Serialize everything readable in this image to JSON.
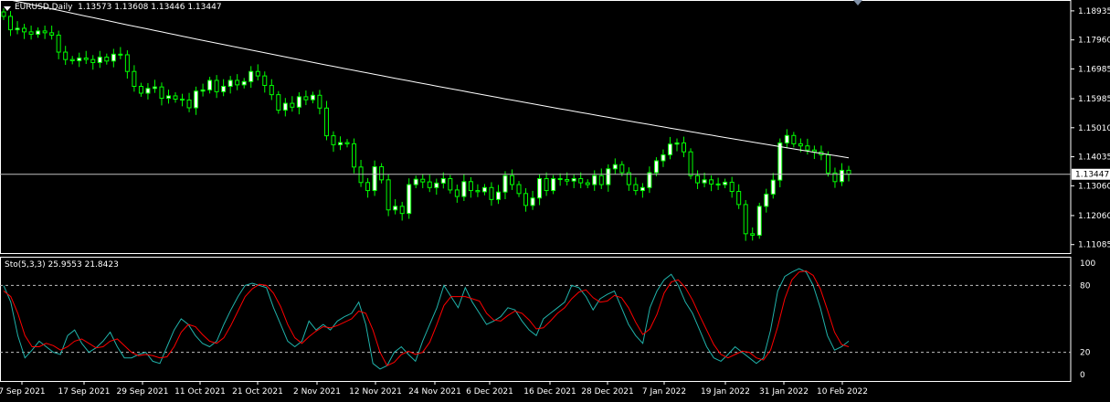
{
  "window": {
    "symbol_header": "EURUSD,Daily  1.13573 1.13608 1.13446 1.13447",
    "oscillator_header": "Sto(5,3,3) 25.9553 21.8423"
  },
  "colors": {
    "background": "#000000",
    "bull_candle": "#00ff00",
    "bear_candle_body": "#ffffff",
    "moving_average": "#ffffff",
    "stoch_main": "#20b2aa",
    "stoch_signal": "#ff0000",
    "grid_frame": "#ffffff",
    "levels": "#c0c0c0"
  },
  "chart_data": [
    {
      "type": "candlestick",
      "symbol": "EURUSD",
      "timeframe": "Daily",
      "ohlc_last": {
        "open": 1.13573,
        "high": 1.13608,
        "low": 1.13446,
        "close": 1.13447
      },
      "y_ticks": [
        1.18935,
        1.1796,
        1.16985,
        1.15985,
        1.1501,
        1.14035,
        1.1306,
        1.1206,
        1.11085
      ],
      "current_price_label": "1.13447",
      "ylim": [
        1.108,
        1.193
      ],
      "x_tick_labels": [
        "7 Sep 2021",
        "17 Sep 2021",
        "29 Sep 2021",
        "11 Oct 2021",
        "21 Oct 2021",
        "2 Nov 2021",
        "12 Nov 2021",
        "24 Nov 2021",
        "6 Dec 2021",
        "16 Dec 2021",
        "28 Dec 2021",
        "7 Jan 2022",
        "19 Jan 2022",
        "31 Jan 2022",
        "10 Feb 2022"
      ],
      "closes": [
        1.1875,
        1.183,
        1.1835,
        1.1823,
        1.1815,
        1.1826,
        1.182,
        1.1812,
        1.1755,
        1.173,
        1.1726,
        1.1735,
        1.173,
        1.172,
        1.1738,
        1.1725,
        1.1748,
        1.1746,
        1.169,
        1.164,
        1.1617,
        1.1633,
        1.1638,
        1.16,
        1.1608,
        1.1597,
        1.1594,
        1.1568,
        1.1624,
        1.1628,
        1.166,
        1.1622,
        1.164,
        1.166,
        1.1645,
        1.1656,
        1.169,
        1.1675,
        1.1643,
        1.1612,
        1.156,
        1.1583,
        1.157,
        1.1605,
        1.1595,
        1.161,
        1.1567,
        1.1474,
        1.1444,
        1.1451,
        1.1447,
        1.1369,
        1.1317,
        1.129,
        1.137,
        1.1326,
        1.1225,
        1.1237,
        1.1213,
        1.131,
        1.1328,
        1.1319,
        1.13,
        1.1315,
        1.133,
        1.1292,
        1.127,
        1.132,
        1.129,
        1.1286,
        1.13,
        1.126,
        1.1285,
        1.134,
        1.131,
        1.128,
        1.124,
        1.1265,
        1.133,
        1.129,
        1.133,
        1.1327,
        1.1322,
        1.133,
        1.1316,
        1.131,
        1.134,
        1.131,
        1.1363,
        1.1377,
        1.135,
        1.131,
        1.129,
        1.13,
        1.135,
        1.139,
        1.141,
        1.1446,
        1.145,
        1.142,
        1.134,
        1.1316,
        1.1326,
        1.1312,
        1.131,
        1.1318,
        1.1287,
        1.1243,
        1.1145,
        1.114,
        1.1237,
        1.1278,
        1.1325,
        1.145,
        1.1475,
        1.1447,
        1.144,
        1.1426,
        1.142,
        1.141,
        1.1349,
        1.132,
        1.1358,
        1.1345
      ],
      "moving_average_label": "",
      "type_note": "candles with moving average overlay"
    },
    {
      "type": "line",
      "title": "Sto(5,3,3) 25.9553 21.8423",
      "y_ticks": [
        100,
        80,
        20,
        0
      ],
      "levels": [
        80,
        20
      ],
      "ylim": [
        0,
        100
      ],
      "series": [
        {
          "name": "",
          "values": [
            80,
            65,
            35,
            15,
            22,
            30,
            25,
            20,
            18,
            35,
            40,
            28,
            20,
            24,
            30,
            38,
            25,
            15,
            15,
            18,
            20,
            12,
            10,
            25,
            40,
            50,
            45,
            35,
            28,
            25,
            30,
            45,
            58,
            70,
            80,
            82,
            80,
            78,
            60,
            45,
            30,
            25,
            30,
            48,
            40,
            45,
            40,
            48,
            52,
            55,
            65,
            45,
            10,
            5,
            8,
            20,
            25,
            18,
            12,
            30,
            45,
            60,
            80,
            70,
            60,
            78,
            65,
            55,
            45,
            48,
            52,
            60,
            58,
            48,
            40,
            35,
            50,
            55,
            60,
            65,
            80,
            78,
            70,
            58,
            68,
            72,
            75,
            60,
            45,
            35,
            28,
            60,
            75,
            85,
            90,
            80,
            65,
            55,
            40,
            25,
            15,
            12,
            18,
            25,
            20,
            15,
            10,
            15,
            40,
            75,
            88,
            92,
            95,
            92,
            80,
            60,
            35,
            22,
            25,
            30
          ]
        },
        {
          "name": "",
          "values": [
            75,
            70,
            55,
            35,
            25,
            25,
            28,
            26,
            22,
            25,
            30,
            32,
            28,
            24,
            25,
            30,
            32,
            26,
            20,
            17,
            18,
            17,
            15,
            16,
            25,
            38,
            45,
            43,
            36,
            30,
            28,
            33,
            44,
            57,
            70,
            77,
            81,
            80,
            73,
            61,
            45,
            33,
            28,
            34,
            39,
            43,
            42,
            44,
            47,
            50,
            57,
            55,
            40,
            20,
            8,
            11,
            18,
            21,
            18,
            20,
            29,
            45,
            62,
            70,
            70,
            70,
            68,
            66,
            55,
            49,
            48,
            53,
            57,
            55,
            49,
            41,
            42,
            48,
            55,
            60,
            68,
            74,
            76,
            69,
            65,
            66,
            71,
            69,
            60,
            47,
            36,
            41,
            54,
            73,
            83,
            85,
            78,
            67,
            53,
            40,
            27,
            18,
            15,
            18,
            21,
            20,
            15,
            13,
            22,
            43,
            68,
            85,
            92,
            93,
            89,
            77,
            58,
            38,
            27,
            25
          ]
        }
      ]
    }
  ]
}
